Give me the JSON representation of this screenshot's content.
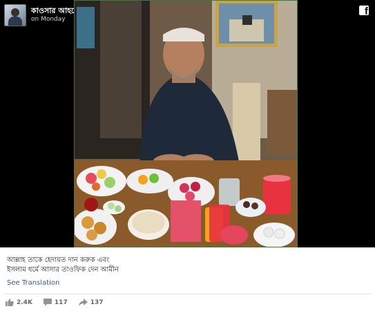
{
  "author": {
    "name": "কাওসার আহমেদ",
    "time": "on Monday"
  },
  "post": {
    "caption_line1": "আল্লাহ তাকে হেদায়ত দান করুক এবং",
    "caption_line2": "ইসলাম ধর্মে আসার তাওফিক দেন আমীন",
    "see_translation": "See Translation"
  },
  "stats": {
    "likes": "2.4K",
    "comments": "117",
    "shares": "137"
  },
  "icons": {
    "brand": "facebook-logo-icon",
    "like": "thumbs-up-icon",
    "comment": "comment-bubble-icon",
    "share": "share-arrow-icon"
  },
  "colors": {
    "link": "#385898",
    "stats_text": "#606770"
  }
}
